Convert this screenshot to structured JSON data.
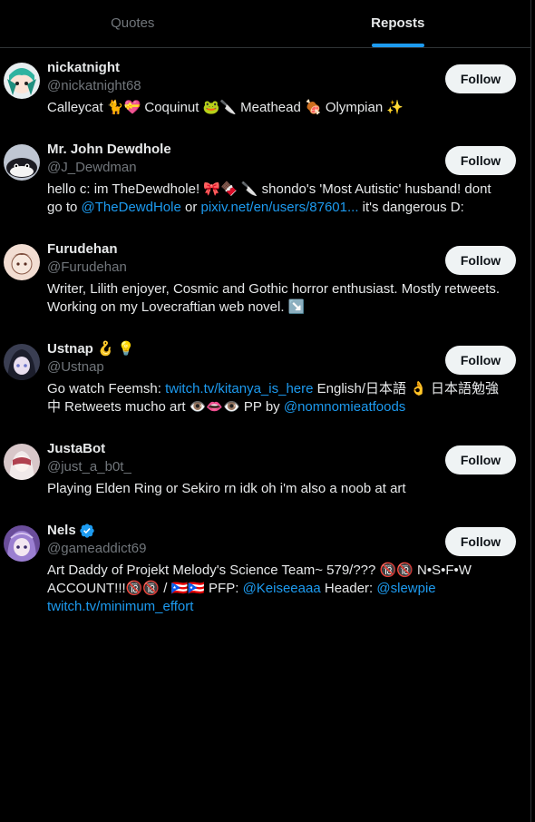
{
  "tabs": [
    {
      "label": "Quotes",
      "active": false
    },
    {
      "label": "Reposts",
      "active": true
    }
  ],
  "follow_label": "Follow",
  "colors": {
    "accent": "#1d9bf0",
    "muted": "#71767b",
    "text": "#e7e9ea",
    "background": "#000000",
    "button_bg": "#eff3f4"
  },
  "users": [
    {
      "name": "nickatnight",
      "handle": "@nickatnight68",
      "bio": [
        {
          "t": "Calleycat 🐈💝 Coquinut 🐸🔪 Meathead 🍖 Olympian ✨"
        }
      ]
    },
    {
      "name": "Mr. John Dewdhole",
      "handle": "@J_Dewdman",
      "bio": [
        {
          "t": "hello c: im TheDewdhole! 🎀🍫 🔪 shondo's 'Most Autistic' husband! dont go to "
        },
        {
          "t": "@TheDewdHole",
          "link": true
        },
        {
          "t": " or "
        },
        {
          "t": "pixiv.net/en/users/87601...",
          "link": true
        },
        {
          "t": " it's dangerous D:"
        }
      ]
    },
    {
      "name": "Furudehan",
      "handle": "@Furudehan",
      "bio": [
        {
          "t": "Writer, Lilith enjoyer, Cosmic and Gothic horror enthusiast. Mostly retweets. Working on my Lovecraftian web novel. ↘️"
        }
      ]
    },
    {
      "name": "Ustnap 🪝 💡",
      "handle": "@Ustnap",
      "bio": [
        {
          "t": "Go watch Feemsh: "
        },
        {
          "t": "twitch.tv/kitanya_is_here",
          "link": true
        },
        {
          "t": " English/日本語 👌 日本語勉強中 Retweets mucho art 👁️👄👁️ PP by "
        },
        {
          "t": "@nomnomieatfoods",
          "link": true
        }
      ]
    },
    {
      "name": "JustaBot",
      "handle": "@just_a_b0t_",
      "bio": [
        {
          "t": "Playing Elden Ring or Sekiro rn idk oh i'm also a noob at art"
        }
      ]
    },
    {
      "name": "Nels",
      "verified": true,
      "handle": "@gameaddict69",
      "bio": [
        {
          "t": "Art Daddy of Projekt Melody's Science Team~ 579/??? 🔞🔞 N•S•F•W ACCOUNT!!!🔞🔞 / 🇵🇷🇵🇷 PFP: "
        },
        {
          "t": "@Keiseeaaa",
          "link": true
        },
        {
          "t": " Header: "
        },
        {
          "t": "@slewpie",
          "link": true
        },
        {
          "t": " "
        },
        {
          "t": "twitch.tv/minimum_effort",
          "link": true
        }
      ]
    }
  ]
}
